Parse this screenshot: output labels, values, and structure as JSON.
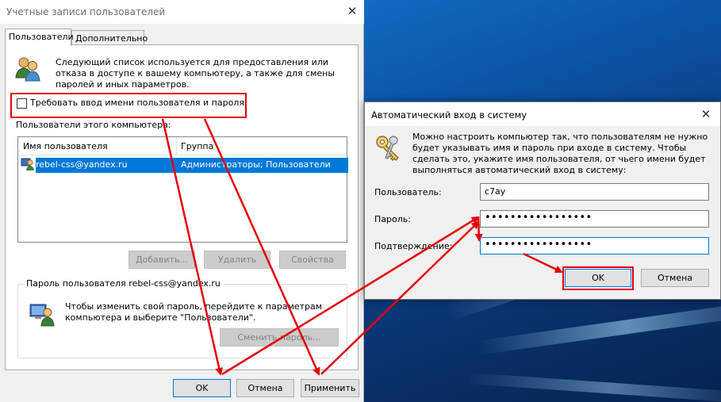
{
  "main_window": {
    "title": "Учетные записи пользователей",
    "tabs": [
      {
        "label": "Пользователи",
        "active": true
      },
      {
        "label": "Дополнительно",
        "active": false
      }
    ],
    "description": "Следующий список используется для предоставления или отказа в доступе к вашему компьютеру, а также для смены паролей и иных параметров.",
    "require_login_checkbox": {
      "label": "Требовать ввод имени пользователя и пароля.",
      "checked": false
    },
    "users_section_label": "Пользователи этого компьютера:",
    "users_table": {
      "columns": [
        "Имя пользователя",
        "Группа"
      ],
      "rows": [
        {
          "user": "rebel-css@yandex.ru",
          "group": "Администраторы; Пользователи",
          "selected": true
        }
      ]
    },
    "list_buttons": {
      "add": "Добавить...",
      "remove": "Удалить",
      "properties": "Свойства"
    },
    "password_group": {
      "title": "Пароль пользователя rebel-css@yandex.ru",
      "text": "Чтобы изменить свой пароль, перейдите к параметрам компьютера и выберите \"Пользователи\".",
      "change_button": "Сменить пароль..."
    },
    "footer_buttons": {
      "ok": "OK",
      "cancel": "Отмена",
      "apply": "Применить"
    }
  },
  "autologin_dialog": {
    "title": "Автоматический вход в систему",
    "description": "Можно настроить компьютер так, что пользователям не нужно будет указывать имя и пароль при входе в систему. Чтобы сделать это, укажите имя пользователя, от чьего имени будет выполняться автоматический вход в систему:",
    "fields": {
      "user_label": "Пользователь:",
      "user_value": "c7ay",
      "password_label": "Пароль:",
      "password_value": "•••••••••••••••••",
      "confirm_label": "Подтверждение:",
      "confirm_value": "•••••••••••••••••"
    },
    "buttons": {
      "ok": "OK",
      "cancel": "Отмена"
    }
  },
  "colors": {
    "highlight": "#e3000b",
    "selection": "#0078d7",
    "window_bg": "#f0f0f0"
  },
  "icons": [
    "users-icon",
    "user-row-icon",
    "keys-icon",
    "user-password-icon",
    "close-icon"
  ]
}
